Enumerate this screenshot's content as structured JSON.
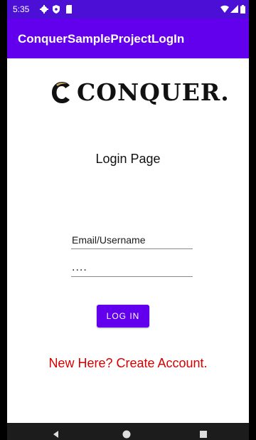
{
  "status_bar": {
    "time": "5:35",
    "left_icons": [
      "gear-icon",
      "shield-icon",
      "sd-card-icon"
    ],
    "right_icons": [
      "wifi-icon",
      "signal-icon",
      "battery-icon"
    ]
  },
  "app_bar": {
    "title": "ConquerSampleProjectLogIn"
  },
  "logo": {
    "text": "CONQUER."
  },
  "page": {
    "title": "Login Page"
  },
  "form": {
    "email_placeholder": "Email/Username",
    "password_value": "....",
    "login_label": "LOG IN",
    "create_account_label": "New Here? Create Account."
  },
  "colors": {
    "status_bar": "#4c0fd6",
    "app_bar": "#6200ee",
    "button": "#6200ee",
    "link": "#d50000",
    "logo_gold": "#c9a766"
  },
  "nav_bar": {
    "buttons": [
      "back-icon",
      "home-icon",
      "recents-icon"
    ]
  }
}
